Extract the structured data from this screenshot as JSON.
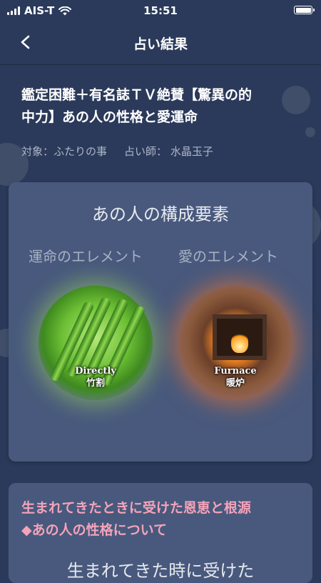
{
  "status_bar": {
    "carrier": "AIS-T",
    "time": "15:51"
  },
  "nav": {
    "title": "占い結果"
  },
  "reading": {
    "title_line1": "鑑定困難＋有名誌ＴＶ絶賛【驚異の的",
    "title_line2": "中力】あの人の性格と愛運命",
    "target_label": "対象：ふたりの事",
    "fortune_teller_label": "占い師：",
    "fortune_teller_name": "水晶玉子"
  },
  "elements_card": {
    "title": "あの人の構成要素",
    "destiny_label": "運命のエレメント",
    "love_label": "愛のエレメント",
    "destiny_element": {
      "en": "Directly",
      "ja": "竹割",
      "icon": "bamboo-icon"
    },
    "love_element": {
      "en": "Furnace",
      "ja": "暖炉",
      "icon": "fireplace-icon"
    }
  },
  "section_card": {
    "heading_line1": "生まれてきたときに受けた恩恵と根源",
    "heading_line2": "◆あの人の性格について",
    "body_text": "生まれてきた時に受けた"
  }
}
